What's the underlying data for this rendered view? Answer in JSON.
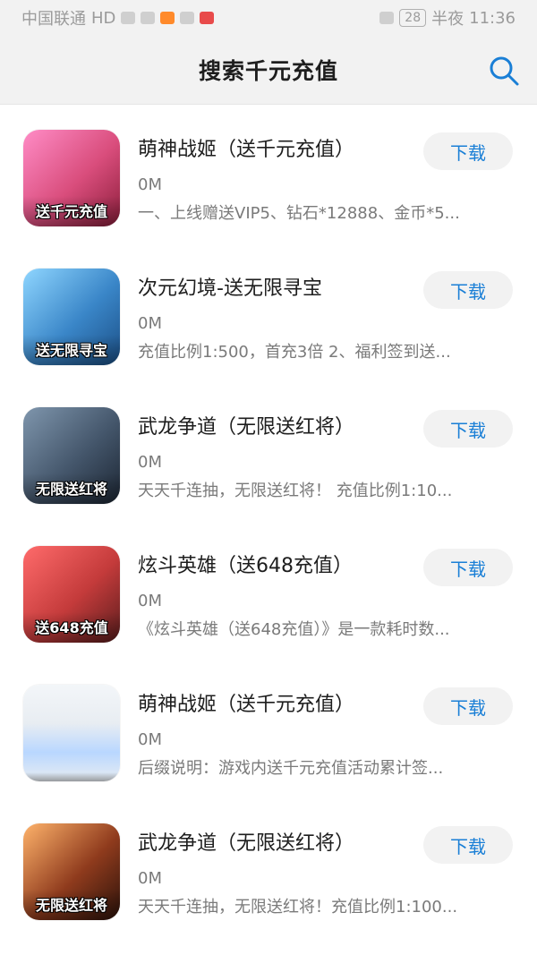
{
  "status_bar": {
    "carrier": "中国联通",
    "night_label": "半夜",
    "time": "11:36",
    "battery": "28",
    "icons": {
      "hd": "HD",
      "signal": "signal-icon",
      "wifi": "wifi-icon",
      "app1": "video-app-icon",
      "app2": "shield-icon",
      "app3": "book-app-icon",
      "eye": "eye-icon"
    }
  },
  "header": {
    "title": "搜索千元充值",
    "search_icon": "search-icon",
    "accent_color": "#1a7fd6"
  },
  "list": {
    "items": [
      {
        "title": "萌神战姬（送千元充值）",
        "size": "0M",
        "desc": "一、上线赠送VIP5、钻石*12888、金币*5...",
        "button": "下载",
        "icon_text": "送千元充值",
        "icon_bg": "#d94d7c"
      },
      {
        "title": "次元幻境-送无限寻宝",
        "size": "0M",
        "desc": "充值比例1:500，首充3倍 2、福利签到送...",
        "button": "下载",
        "icon_text": "送无限寻宝",
        "icon_bg": "#3a86c8"
      },
      {
        "title": "武龙争道（无限送红将）",
        "size": "0M",
        "desc": "天天千连抽，无限送红将！ 充值比例1:10...",
        "button": "下载",
        "icon_text": "无限送红将",
        "icon_bg": "#44566b"
      },
      {
        "title": "炫斗英雄（送648充值）",
        "size": "0M",
        "desc": "《炫斗英雄（送648充值）》是一款耗时数...",
        "button": "下载",
        "icon_text": "送648充值",
        "icon_bg": "#c43b3b"
      },
      {
        "title": "萌神战姬（送千元充值）",
        "size": "0M",
        "desc": "后缀说明：游戏内送千元充值活动累计签...",
        "button": "下载",
        "icon_text": "",
        "icon_bg": "#e8edf2"
      },
      {
        "title": "武龙争道（无限送红将）",
        "size": "0M",
        "desc": "天天千连抽，无限送红将！充值比例1:100...",
        "button": "下载",
        "icon_text": "无限送红将",
        "icon_bg": "#8f3b1d"
      }
    ]
  }
}
